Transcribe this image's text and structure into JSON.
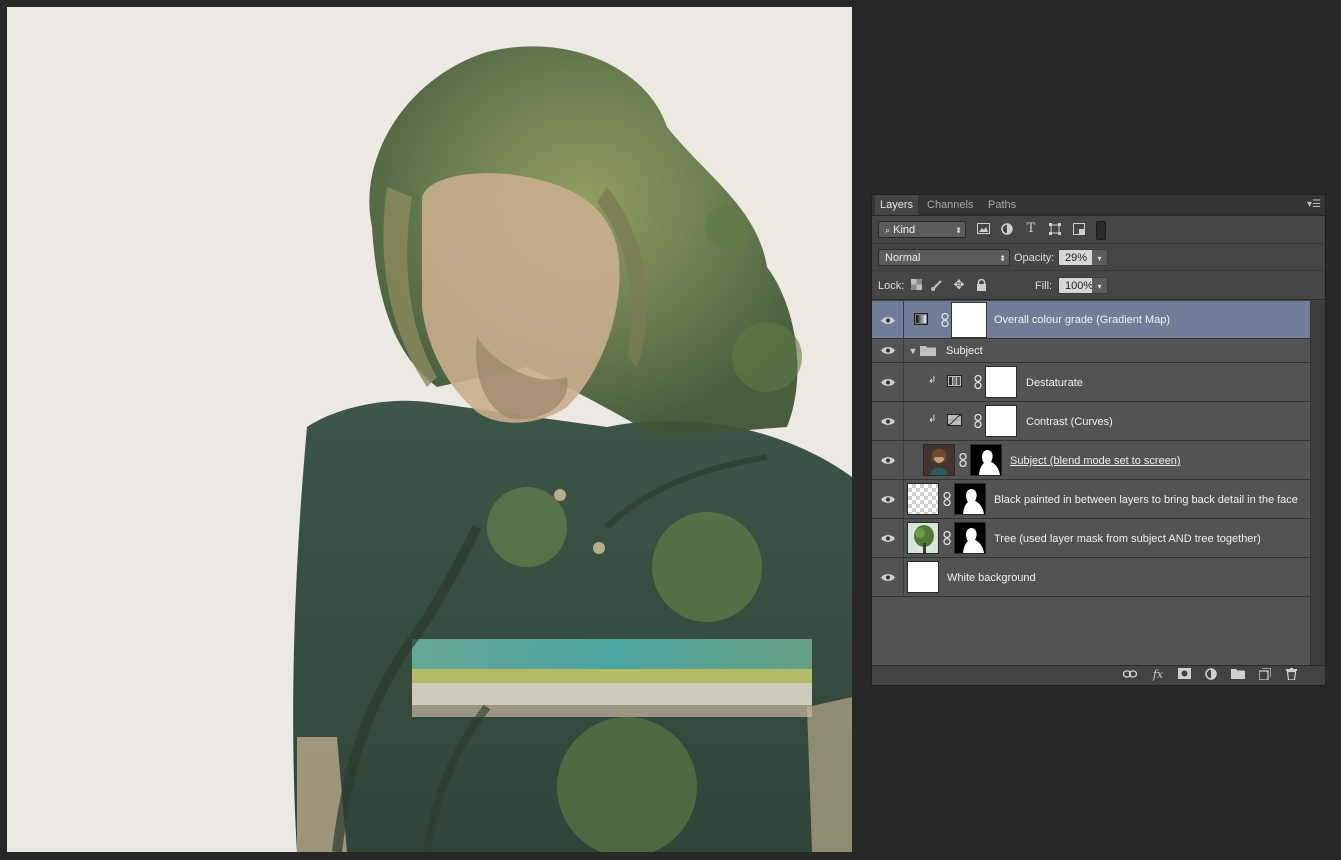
{
  "panel": {
    "tabs": [
      "Layers",
      "Channels",
      "Paths"
    ],
    "active_tab": "Layers",
    "filter": {
      "label": "Kind"
    },
    "blend_mode": "Normal",
    "opacity_label": "Opacity:",
    "opacity_value": "29%",
    "lock_label": "Lock:",
    "fill_label": "Fill:",
    "fill_value": "100%"
  },
  "layers": [
    {
      "name": "Overall colour grade (Gradient Map)",
      "type": "adjustment-gradient-map",
      "visible": true,
      "selected": true
    },
    {
      "name": "Subject",
      "type": "group",
      "visible": true,
      "expanded": true
    },
    {
      "name": "Destaturate",
      "type": "adjustment-hue-saturation",
      "visible": true,
      "clipped": true
    },
    {
      "name": "Contrast (Curves)",
      "type": "adjustment-curves",
      "visible": true,
      "clipped": true
    },
    {
      "name": "Subject (blend mode set to screen)",
      "type": "pixel-photo-masked",
      "visible": true,
      "underlined": true
    },
    {
      "name": "Black painted in between layers to bring back detail in the face",
      "type": "pixel-transparent-masked",
      "visible": true
    },
    {
      "name": "Tree (used layer mask from subject AND tree together)",
      "type": "pixel-tree-masked",
      "visible": true
    },
    {
      "name": "White background",
      "type": "pixel-white",
      "visible": true
    }
  ],
  "colors": {
    "canvas_background": "#ece9e2",
    "selected_layer": "#6f7d99",
    "workspace": "#282828"
  }
}
